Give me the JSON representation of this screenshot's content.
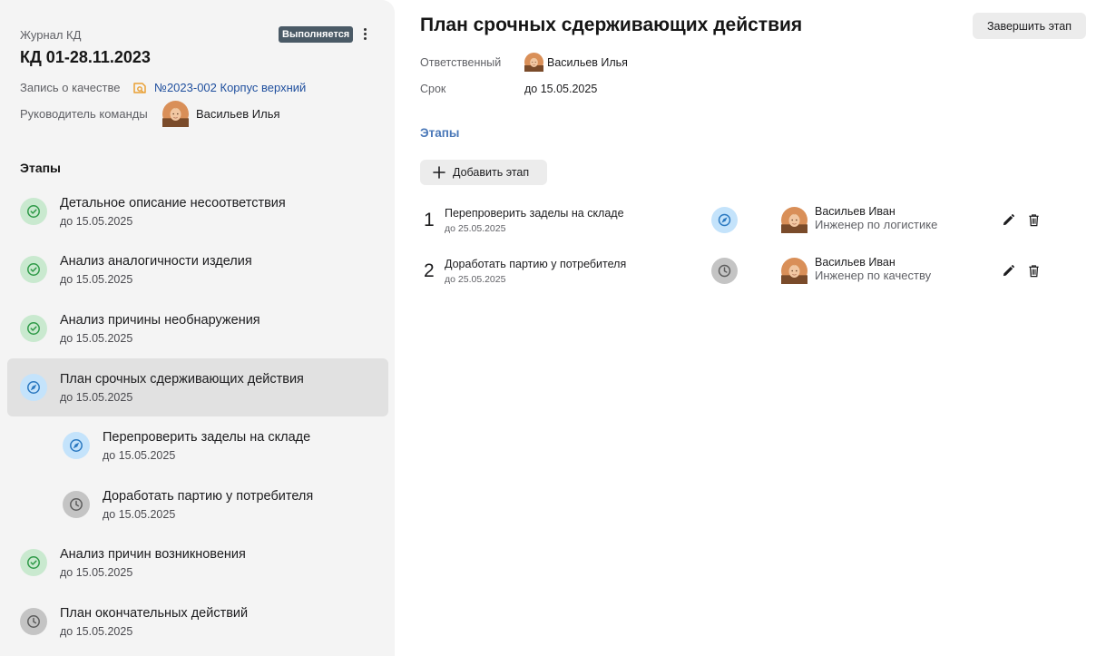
{
  "sidebar": {
    "journal_label": "Журнал КД",
    "status_badge": "Выполняется",
    "title": "КД 01-28.11.2023",
    "quality_record_label": "Запись о качестве",
    "quality_record_link": "№2023-002 Корпус верхний",
    "team_leader_label": "Руководитель команды",
    "team_leader_name": "Васильев Илья",
    "stages_heading": "Этапы",
    "stages": [
      {
        "name": "Детальное описание несоответствия",
        "date": "до 15.05.2025",
        "status": "done"
      },
      {
        "name": "Анализ аналогичности изделия",
        "date": "до 15.05.2025",
        "status": "done"
      },
      {
        "name": "Анализ причины необнаружения",
        "date": "до 15.05.2025",
        "status": "done"
      },
      {
        "name": "План срочных сдерживающих действия",
        "date": "до 15.05.2025",
        "status": "in-progress"
      },
      {
        "name": "Перепроверить заделы на складе",
        "date": "до 15.05.2025",
        "status": "in-progress"
      },
      {
        "name": "Доработать партию у потребителя",
        "date": "до 15.05.2025",
        "status": "pending"
      },
      {
        "name": "Анализ причин возникновения",
        "date": "до 15.05.2025",
        "status": "done"
      },
      {
        "name": "План окончательных действий",
        "date": "до 15.05.2025",
        "status": "pending"
      }
    ]
  },
  "main": {
    "title": "План срочных сдерживающих действия",
    "finish_button": "Завершить этап",
    "responsible_label": "Ответственный",
    "responsible_name": "Васильев Илья",
    "deadline_label": "Срок",
    "deadline_value": "до 15.05.2025",
    "stages_tab": "Этапы",
    "add_stage_button": "Добавить этап",
    "tasks": [
      {
        "number": "1",
        "name": "Перепроверить заделы на складе",
        "date": "до 25.05.2025",
        "status": "in-progress",
        "assignee": "Васильев Иван",
        "role": "Инженер по логистике"
      },
      {
        "number": "2",
        "name": "Доработать партию у потребителя",
        "date": "до 25.05.2025",
        "status": "pending",
        "assignee": "Васильев Иван",
        "role": "Инженер по качеству"
      }
    ]
  },
  "colors": {
    "done_bg": "#c9e9cf",
    "done_fg": "#2f9a48",
    "progress_bg": "#c4e3fb",
    "progress_fg": "#2a78c0",
    "pending_bg": "#c4c4c4",
    "pending_fg": "#5c5c5c",
    "badge": "#4a5a66",
    "link": "#1f4f9e",
    "tab_accent": "#4a78b8"
  }
}
